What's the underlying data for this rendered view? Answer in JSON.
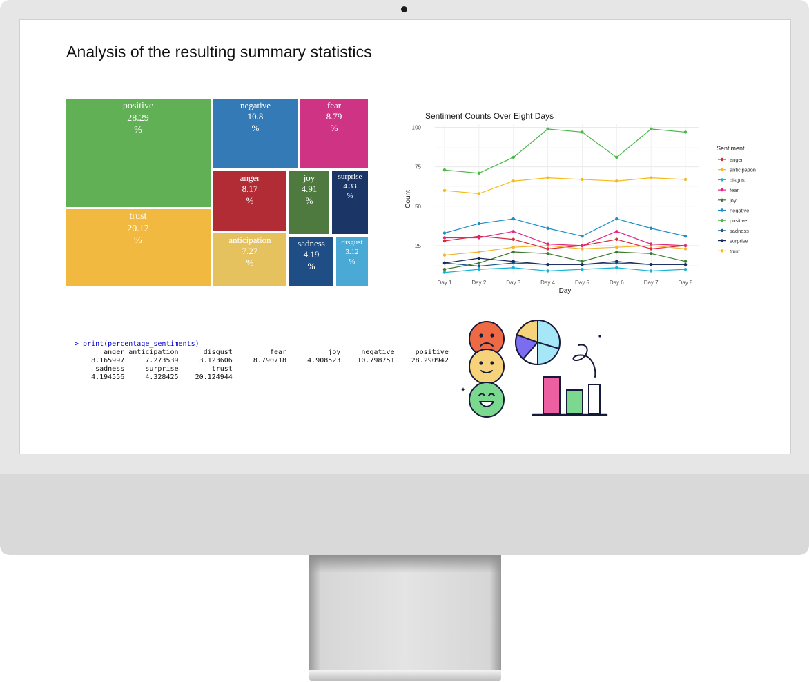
{
  "slide": {
    "title": "Analysis of the resulting summary statistics"
  },
  "treemap": {
    "tiles": [
      {
        "id": "positive",
        "label": "positive",
        "value": "28.29",
        "unit": "%",
        "color": "#62b055"
      },
      {
        "id": "trust",
        "label": "trust",
        "value": "20.12",
        "unit": "%",
        "color": "#f2b940"
      },
      {
        "id": "negative",
        "label": "negative",
        "value": "10.8",
        "unit": "%",
        "color": "#337ab7"
      },
      {
        "id": "fear",
        "label": "fear",
        "value": "8.79",
        "unit": "%",
        "color": "#cf3484"
      },
      {
        "id": "anger",
        "label": "anger",
        "value": "8.17",
        "unit": "%",
        "color": "#b12c35"
      },
      {
        "id": "anticipation",
        "label": "anticipation",
        "value": "7.27",
        "unit": "%",
        "color": "#e5c25d"
      },
      {
        "id": "joy",
        "label": "joy",
        "value": "4.91",
        "unit": "%",
        "color": "#4f7a3f"
      },
      {
        "id": "surprise",
        "label": "surprise",
        "value": "4.33",
        "unit": "%",
        "color": "#1b3566"
      },
      {
        "id": "sadness",
        "label": "sadness",
        "value": "4.19",
        "unit": "%",
        "color": "#1f4e86"
      },
      {
        "id": "disgust",
        "label": "disgust",
        "value": "3.12",
        "unit": "%",
        "color": "#4ba9d6"
      }
    ]
  },
  "chart_data": [
    {
      "type": "treemap",
      "categories": [
        "positive",
        "trust",
        "negative",
        "fear",
        "anger",
        "anticipation",
        "joy",
        "surprise",
        "sadness",
        "disgust"
      ],
      "values": [
        28.29,
        20.12,
        10.8,
        8.79,
        8.17,
        7.27,
        4.91,
        4.33,
        4.19,
        3.12
      ]
    },
    {
      "type": "line",
      "title": "Sentiment Counts Over Eight Days",
      "xlabel": "Day",
      "ylabel": "Count",
      "categories": [
        "Day 1",
        "Day 2",
        "Day 3",
        "Day 4",
        "Day 5",
        "Day 6",
        "Day 7",
        "Day 8"
      ],
      "ylim": [
        7,
        102
      ],
      "yticks": [
        25,
        50,
        75,
        100
      ],
      "grid": true,
      "legend_title": "Sentiment",
      "legend_position": "right",
      "series": [
        {
          "name": "anger",
          "color": "#d42a3c",
          "values": [
            28,
            31,
            29,
            23,
            25,
            29,
            23,
            25
          ]
        },
        {
          "name": "anticipation",
          "color": "#f2b52e",
          "values": [
            19,
            21,
            24,
            25,
            23,
            24,
            25,
            23
          ]
        },
        {
          "name": "disgust",
          "color": "#13b3d6",
          "values": [
            8,
            10,
            11,
            9,
            10,
            11,
            9,
            10
          ]
        },
        {
          "name": "fear",
          "color": "#e0277f",
          "values": [
            30,
            30,
            34,
            26,
            25,
            34,
            26,
            25
          ]
        },
        {
          "name": "joy",
          "color": "#3c7a33",
          "values": [
            10,
            14,
            21,
            20,
            15,
            21,
            20,
            15
          ]
        },
        {
          "name": "negative",
          "color": "#1f8cc4",
          "values": [
            33,
            39,
            42,
            36,
            31,
            42,
            36,
            31
          ]
        },
        {
          "name": "positive",
          "color": "#4cb648",
          "values": [
            73,
            71,
            81,
            99,
            97,
            81,
            99,
            97
          ]
        },
        {
          "name": "sadness",
          "color": "#175a8a",
          "values": [
            14,
            12,
            14,
            13,
            13,
            14,
            13,
            13
          ]
        },
        {
          "name": "surprise",
          "color": "#1c2a5a",
          "values": [
            14,
            17,
            15,
            13,
            13,
            15,
            13,
            13
          ]
        },
        {
          "name": "trust",
          "color": "#f6b91a",
          "values": [
            60,
            58,
            66,
            68,
            67,
            66,
            68,
            67
          ]
        }
      ]
    }
  ],
  "console": {
    "command": "> print(percentage_sentiments)",
    "rows": [
      "       anger anticipation      disgust         fear          joy     negative     positive ",
      "    8.165997     7.273539     3.123606     8.790718     4.908523    10.798751    28.290942 ",
      "     sadness     surprise        trust ",
      "    4.194556     4.328425    20.124944 "
    ]
  },
  "illustration": {
    "icon": "emotion-analytics-illustration",
    "colors": {
      "sad": "#ee6a45",
      "neutral": "#f6d27a",
      "happy": "#7ad88f",
      "bar_pink": "#ec5fa0",
      "pie_blue": "#a6e7f7",
      "pie_purple": "#7b6cf0"
    }
  }
}
